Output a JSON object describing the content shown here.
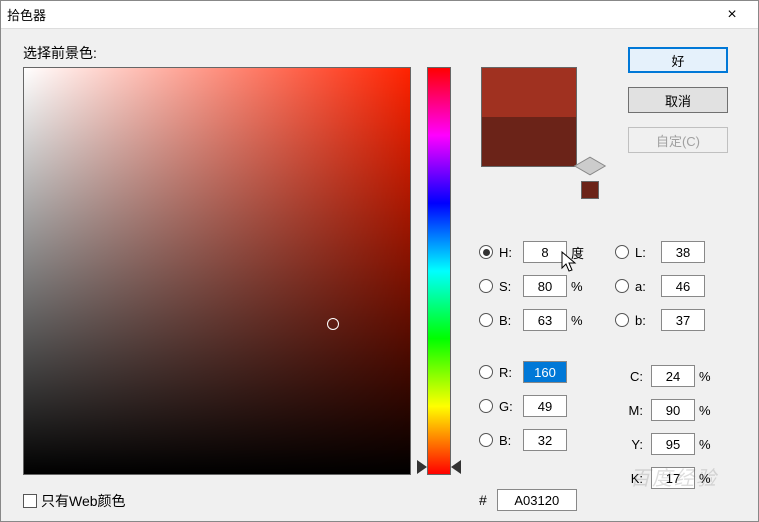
{
  "window": {
    "title": "拾色器",
    "close": "×"
  },
  "label": {
    "foreground": "选择前景色:",
    "webonly": "只有Web颜色"
  },
  "buttons": {
    "ok": "好",
    "cancel": "取消",
    "custom": "自定(C)"
  },
  "preview": {
    "new_color": "#A03120",
    "old_color": "#6B2318",
    "mini": "#6B2318"
  },
  "hsb": {
    "h": {
      "label": "H:",
      "value": "8",
      "unit": "度",
      "selected": true
    },
    "s": {
      "label": "S:",
      "value": "80",
      "unit": "%",
      "selected": false
    },
    "b": {
      "label": "B:",
      "value": "63",
      "unit": "%",
      "selected": false
    }
  },
  "lab": {
    "l": {
      "label": "L:",
      "value": "38",
      "selected": false
    },
    "a": {
      "label": "a:",
      "value": "46",
      "selected": false
    },
    "b": {
      "label": "b:",
      "value": "37",
      "selected": false
    }
  },
  "rgb": {
    "r": {
      "label": "R:",
      "value": "160",
      "selected": false,
      "highlighted": true
    },
    "g": {
      "label": "G:",
      "value": "49",
      "selected": false
    },
    "b": {
      "label": "B:",
      "value": "32",
      "selected": false
    }
  },
  "cmyk": {
    "c": {
      "label": "C:",
      "value": "24",
      "unit": "%"
    },
    "m": {
      "label": "M:",
      "value": "90",
      "unit": "%"
    },
    "y": {
      "label": "Y:",
      "value": "95",
      "unit": "%"
    },
    "k": {
      "label": "K:",
      "value": "17",
      "unit": "%"
    }
  },
  "hex": {
    "label": "#",
    "value": "A03120"
  },
  "cursor_pos": {
    "x_pct": 80,
    "y_pct": 37
  },
  "hue_pos_pct": 97.7,
  "watermark": "百度经验"
}
